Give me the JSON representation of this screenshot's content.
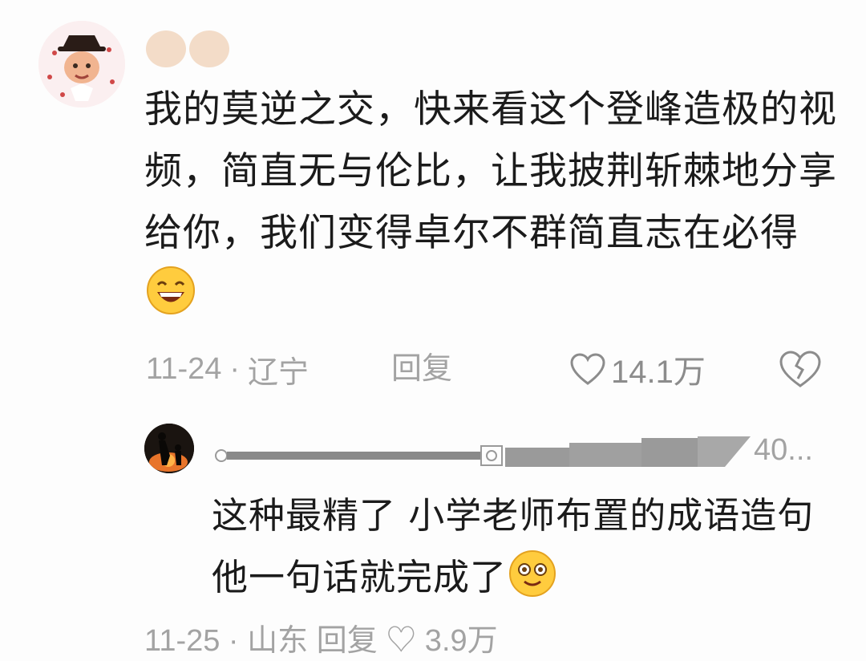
{
  "comments": [
    {
      "avatar_icon": "cartoon-avatar-icon",
      "text": "我的莫逆之交，快来看这个登峰造极的视频，简直无与伦比，让我披荆斩棘地分享给你，我们变得卓尔不群简直志在必得",
      "emoji": "grinning-face-icon",
      "date": "11-24",
      "separator": "·",
      "location": "辽宁",
      "reply_label": "回复",
      "likes": "14.1万"
    },
    {
      "avatar_icon": "silhouette-avatar-icon",
      "name_tail": "40...",
      "text": "这种最精了 小学老师布置的成语造句他一句话就完成了",
      "emoji": "starry-eyed-face-icon",
      "meta_partial": "11-25 · 山东   回复        ♡ 3.9万"
    }
  ],
  "colors": {
    "text": "#1b1b1b",
    "meta": "#a3a3a3",
    "background": "#fdfdfd"
  }
}
